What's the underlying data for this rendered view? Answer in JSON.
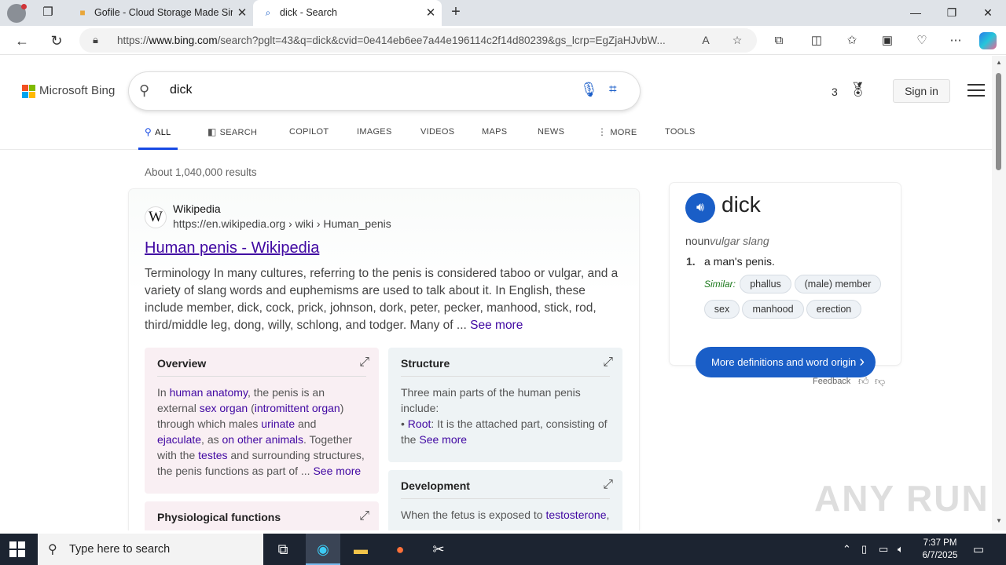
{
  "browser": {
    "tabs": [
      {
        "title": "Gofile - Cloud Storage Made Sim",
        "icon": "folder-icon"
      },
      {
        "title": "dick - Search",
        "icon": "search-icon"
      }
    ],
    "url_prefix": "https://",
    "url_host": "www.bing.com",
    "url_rest": "/search?pglt=43&q=dick&cvid=0e414eb6ee7a44e196114c2f14d80239&gs_lcrp=EgZjaHJvbW..."
  },
  "bing": {
    "logo_text": "Microsoft Bing",
    "query": "dick",
    "rewards_count": "3",
    "sign_in": "Sign in",
    "nav": [
      "ALL",
      "SEARCH",
      "COPILOT",
      "IMAGES",
      "VIDEOS",
      "MAPS",
      "NEWS",
      "MORE",
      "TOOLS"
    ],
    "results_count": "About 1,040,000 results"
  },
  "result": {
    "site_name": "Wikipedia",
    "site_url": "https://en.wikipedia.org › wiki › Human_penis",
    "title": "Human penis - Wikipedia",
    "snippet": "Terminology In many cultures, referring to the penis is considered taboo or vulgar, and a variety of slang words and euphemisms are used to talk about it. In English, these include member, dick, cock, prick, johnson, dork, peter, pecker, manhood, stick, rod, third/middle leg, dong, willy, schlong, and todger. Many of ...",
    "see_more": "See more",
    "overview": {
      "title": "Overview",
      "parts": [
        {
          "t": "In ",
          "l": false
        },
        {
          "t": "human anatomy",
          "l": true
        },
        {
          "t": ", the penis is an external ",
          "l": false
        },
        {
          "t": "sex organ",
          "l": true
        },
        {
          "t": " (",
          "l": false
        },
        {
          "t": "intromittent organ",
          "l": true
        },
        {
          "t": ") through which males ",
          "l": false
        },
        {
          "t": "urinate",
          "l": true
        },
        {
          "t": " and ",
          "l": false
        },
        {
          "t": "ejaculate",
          "l": true
        },
        {
          "t": ", as ",
          "l": false
        },
        {
          "t": "on other animals",
          "l": true
        },
        {
          "t": ". Together with the ",
          "l": false
        },
        {
          "t": "testes",
          "l": true
        },
        {
          "t": " and surrounding structures, the penis functions as part of ... ",
          "l": false
        },
        {
          "t": "See more",
          "l": true
        }
      ]
    },
    "structure": {
      "title": "Structure",
      "parts": [
        {
          "t": "Three main parts of the human penis include:",
          "l": false,
          "br": true
        },
        {
          "t": "• ",
          "l": false
        },
        {
          "t": "Root",
          "l": true
        },
        {
          "t": ": It is the attached part, consisting of the ",
          "l": false
        },
        {
          "t": "See more",
          "l": true
        }
      ]
    },
    "physiological": {
      "title": "Physiological functions"
    },
    "development": {
      "title": "Development",
      "parts": [
        {
          "t": "When the fetus is exposed to ",
          "l": false
        },
        {
          "t": "testosterone",
          "l": true
        },
        {
          "t": ",",
          "l": false
        }
      ]
    }
  },
  "dictionary": {
    "word": "dick",
    "pos": "noun",
    "register": "vulgar slang",
    "def_num": "1.",
    "definition": "a man's penis.",
    "similar_label": "Similar:",
    "similar": [
      "phallus",
      "(male) member",
      "sex",
      "manhood",
      "erection"
    ],
    "more_button": "More definitions and word origin",
    "feedback": "Feedback"
  },
  "watermark": "ANY RUN",
  "taskbar": {
    "search_placeholder": "Type here to search",
    "time": "7:37 PM",
    "date": "6/7/2025"
  },
  "colors": {
    "link": "#4007a2",
    "accent": "#1a5ec7",
    "active_tab_underline": "#174ae4"
  }
}
